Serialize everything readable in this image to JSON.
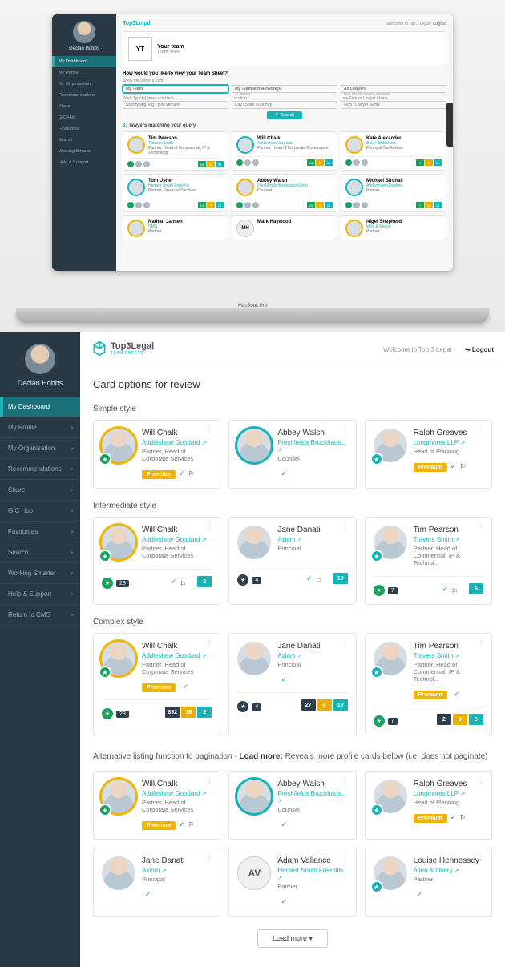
{
  "app": {
    "brand": "Top3Legal",
    "subbrand": "TEAM SHEETS",
    "welcome": "Welcome to Top 3 Legal",
    "logout": "Logout",
    "macbook": "MacBook Pro"
  },
  "user": {
    "name": "Declan Hobbs"
  },
  "sidebar": {
    "items": [
      {
        "label": "My Dashboard",
        "active": true
      },
      {
        "label": "My Profile"
      },
      {
        "label": "My Organisation"
      },
      {
        "label": "Recommendations"
      },
      {
        "label": "Share"
      },
      {
        "label": "GIC Hub"
      },
      {
        "label": "Favourites"
      },
      {
        "label": "Search"
      },
      {
        "label": "Working Smarter"
      },
      {
        "label": "Help & Support"
      },
      {
        "label": "Return to CMS"
      }
    ]
  },
  "laptop": {
    "title": "Your team",
    "subtitle": "Team Sheet",
    "init": "YT",
    "prompt": "How would you like to view your Team Sheet?",
    "filter_label": "Show the lawyers from:",
    "tabs": [
      "My Team",
      "My Team and Network(s)",
      "All Lawyers"
    ],
    "tabSubs": [
      "15 lawyers",
      "57 lawyers",
      "Over 100,000 lawyers worldwide"
    ],
    "filters": {
      "worktype": "Work Type(s) (max selected)",
      "worktype_ph": "Start typing, e.g. \"joint venture\"",
      "loc": "Location",
      "loc_ph": "City / State / Country",
      "firm": "Law Firm or Lawyer Name",
      "firm_ph": "Firm / Lawyer Name"
    },
    "search": "Search",
    "result": "87 lawyers matching your query",
    "cards": [
      {
        "name": "Tim Pearson",
        "org": "Travers Smith",
        "role": "Partner, Head of Commercial, IP & Technology",
        "pills": [
          "28",
          "38",
          "37"
        ]
      },
      {
        "name": "Will Chalk",
        "org": "Addleshaw Goddard",
        "role": "Partner, Head of Corporate Governance",
        "pills": [
          "18",
          "8",
          "26"
        ]
      },
      {
        "name": "Kate Alexander",
        "org": "Baker McKenzie",
        "role": "Principal Tax Advisor",
        "pills": [
          "4",
          "5",
          "16"
        ]
      },
      {
        "name": "Tom Usher",
        "org": "Herbert Smith Freehills",
        "role": "Partner, Financial Services",
        "pills": [
          "14",
          "7",
          "16"
        ]
      },
      {
        "name": "Abbey Walsh",
        "org": "Freshfields Bruckhaus Derin...",
        "role": "Counsel",
        "pills": [
          "15",
          "5",
          "16"
        ]
      },
      {
        "name": "Michael Birchall",
        "org": "Addleshaw Goddard",
        "role": "Partner",
        "pills": [
          "7",
          "16",
          "12"
        ]
      },
      {
        "name": "Nathan Jansen",
        "org": "CMS",
        "role": "Partner"
      },
      {
        "name": "Mark Haywood",
        "org": "",
        "role": "",
        "init": "MH"
      },
      {
        "name": "Nigel Shepherd",
        "org": "Mills & Reeve",
        "role": "Partner"
      }
    ]
  },
  "page": {
    "title": "Card options for review",
    "sections": {
      "simple": {
        "title": "Simple style",
        "cards": [
          {
            "name": "Will Chalk",
            "org": "Addleshaw Goodard",
            "role": "Partner, Head of Corporate Services",
            "premium": "Premium",
            "ring": "prem"
          },
          {
            "name": "Abbey Walsh",
            "org": "Freshfields Bruckhaus...",
            "role": "Counsel",
            "ring": "teal"
          },
          {
            "name": "Ralph Greaves",
            "org": "Longmores LLP",
            "role": "Head of Planning",
            "premium": "Premium",
            "ring": "star"
          }
        ]
      },
      "inter": {
        "title": "Intermediate style",
        "cards": [
          {
            "name": "Will Chalk",
            "org": "Addleshaw Goodard",
            "role": "Partner, Head of Corporate Services",
            "badges": {
              "star": true,
              "n": "28"
            },
            "right": [
              "2"
            ],
            "ring": "prem"
          },
          {
            "name": "Jane Danati",
            "org": "Axiom",
            "role": "Principal",
            "badges": {
              "n": "4"
            },
            "right": [
              "19"
            ]
          },
          {
            "name": "Tim Pearson",
            "org": "Travers Smith",
            "role": "Partner, Head of Commercial, IP & Technol...",
            "badges": {
              "star": true,
              "n": "7"
            },
            "right": [
              "6"
            ],
            "ring": "star"
          }
        ]
      },
      "complex": {
        "title": "Complex style",
        "cards": [
          {
            "name": "Will Chalk",
            "org": "Addleshaw Goodard",
            "role": "Partner, Head of Corporate Services",
            "premium": "Premium",
            "badges": {
              "star": true,
              "n": "28"
            },
            "right": [
              "892",
              "16",
              "2"
            ],
            "ring": "prem"
          },
          {
            "name": "Jane Danati",
            "org": "Axiom",
            "role": "Principal",
            "badges": {
              "n": "4"
            },
            "right": [
              "27",
              "4",
              "19"
            ]
          },
          {
            "name": "Tim Pearson",
            "org": "Travers Smith",
            "role": "Partner, Head of Commercial, IP & Technol...",
            "premium": "Premium",
            "badges": {
              "star": true,
              "n": "7"
            },
            "right": [
              "2",
              "0",
              "6"
            ],
            "ring": "star"
          }
        ]
      },
      "loadmore": {
        "intro": "Alternative listing function to pagination - ",
        "bold": "Load more:",
        "rest": " Reveals more profile cards below (i.e. does not paginate)",
        "btn": "Load more",
        "cards": [
          {
            "name": "Will Chalk",
            "org": "Addleshaw Goodard",
            "role": "Partner, Head of Corporate Services",
            "premium": "Premium",
            "ring": "prem"
          },
          {
            "name": "Abbey Walsh",
            "org": "Freshfields Bruckhaus...",
            "role": "Counsel",
            "ring": "teal"
          },
          {
            "name": "Ralph Greaves",
            "org": "Longmores LLP",
            "role": "Head of Planning",
            "premium": "Premium",
            "ring": "star"
          },
          {
            "name": "Jane Danati",
            "org": "Axiom",
            "role": "Principal"
          },
          {
            "name": "Adam Vallance",
            "org": "Herbert Smith Freehills",
            "role": "Partner",
            "init": "AV"
          },
          {
            "name": "Louise Hennessey",
            "org": "Allen & Overy",
            "role": "Partner",
            "ring": "star"
          }
        ]
      }
    }
  }
}
